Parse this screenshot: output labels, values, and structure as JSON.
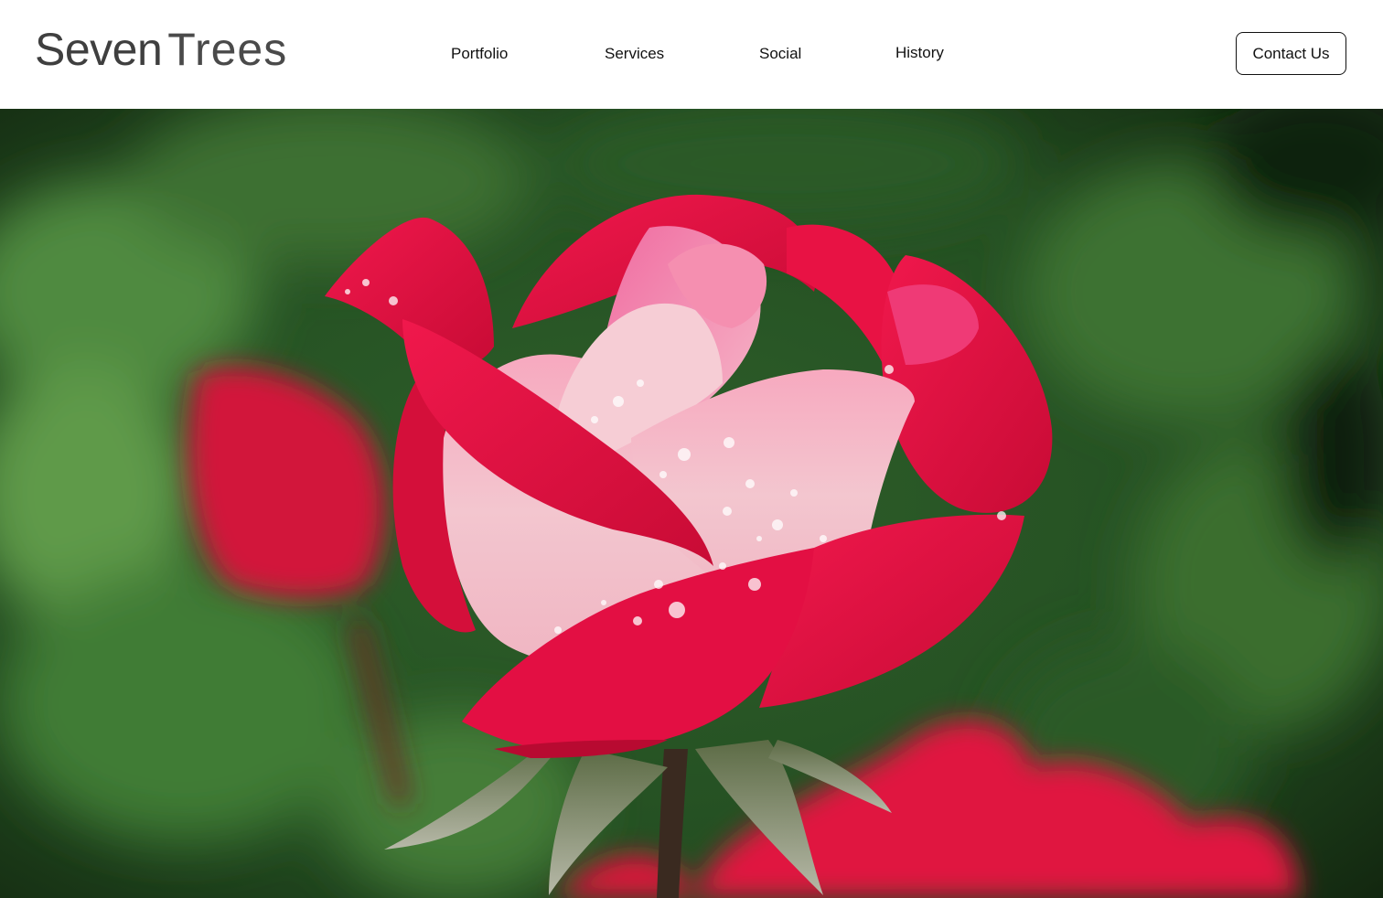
{
  "brand": {
    "name_part1": "Seven",
    "name_part2": "Trees"
  },
  "nav": {
    "items": [
      {
        "label": "Portfolio"
      },
      {
        "label": "Services"
      },
      {
        "label": "Social"
      },
      {
        "label": "History"
      }
    ],
    "cta_label": "Contact Us"
  },
  "hero": {
    "subject": "red-pink rose with dew drops",
    "colors": {
      "petal_red": "#e0103f",
      "petal_pink": "#f4b2c2",
      "foliage": "#2f6a2c"
    }
  }
}
